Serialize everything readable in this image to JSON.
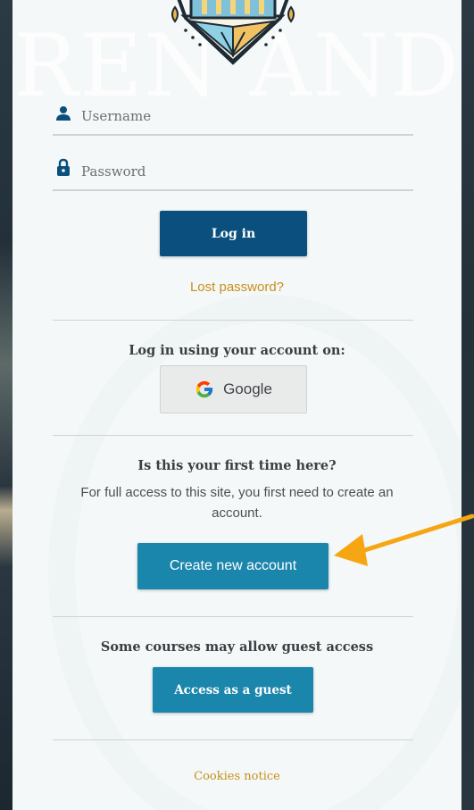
{
  "watermark": {
    "text": "REN AND"
  },
  "login": {
    "username_placeholder": "Username",
    "password_placeholder": "Password",
    "login_label": "Log in",
    "lost_password": "Lost password?"
  },
  "sso": {
    "heading": "Log in using your account on:",
    "google_label": "Google"
  },
  "signup": {
    "heading": "Is this your first time here?",
    "text": "For full access to this site, you first need to create an account.",
    "create_label": "Create new account"
  },
  "guest": {
    "heading": "Some courses may allow guest access",
    "button_label": "Access as a guest"
  },
  "footer": {
    "cookies": "Cookies notice"
  },
  "icons": {
    "username": "user-icon",
    "password": "lock-icon",
    "google": "google-g-icon",
    "annotation": "arrow-pointer-icon"
  },
  "colors": {
    "primary": "#0a4f7e",
    "secondary": "#1b86ac",
    "link": "#c8901a",
    "annotation_arrow": "#f5a612",
    "panel_bg": "#f4f8f8"
  }
}
